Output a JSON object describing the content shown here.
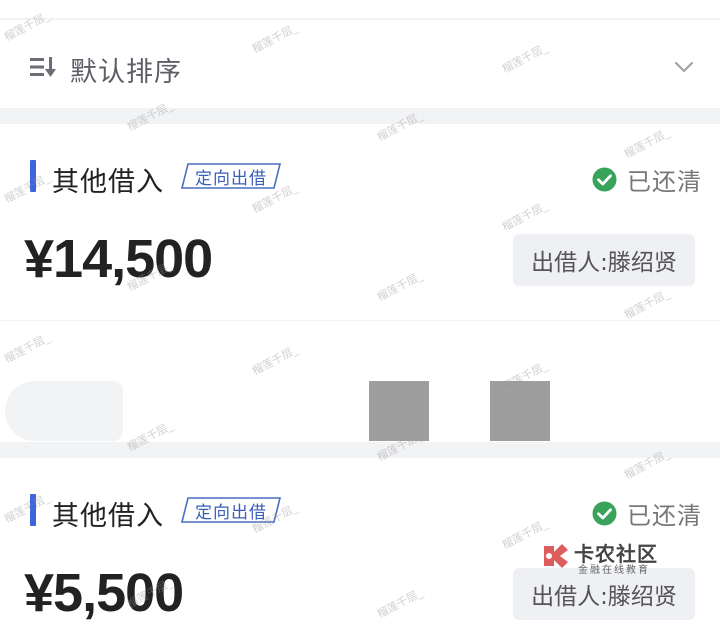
{
  "sort": {
    "label": "默认排序"
  },
  "records": [
    {
      "category": "其他借入",
      "tag": "定向出借",
      "status": "已还清",
      "amount": "¥14,500",
      "lender": "出借人:滕绍贤"
    },
    {
      "category": "其他借入",
      "tag": "定向出借",
      "status": "已还清",
      "amount": "¥5,500",
      "lender": "出借人:滕绍贤"
    }
  ],
  "watermark": "榴莲千层_",
  "brand": {
    "name": "卡农社区",
    "sub": "金融在线教育"
  },
  "colors": {
    "accent": "#3e63dd",
    "tag": "#3a5fb8",
    "check": "#3aa35b",
    "background": "#f2f3f5"
  }
}
